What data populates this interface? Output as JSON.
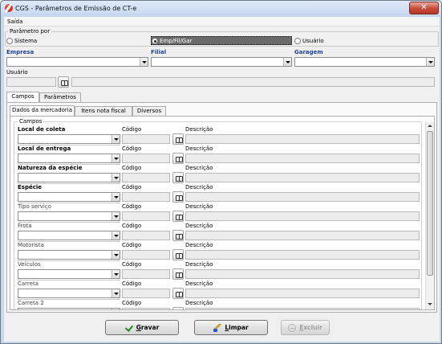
{
  "window": {
    "title": "CGS - Parâmetros de Emissão de CT-e",
    "close_glyph": "✕"
  },
  "menu": {
    "items": [
      {
        "label": "Saída"
      }
    ]
  },
  "parametro": {
    "group_label": "Parâmetro por",
    "options": [
      {
        "label": "Sistema",
        "selected": false
      },
      {
        "label": "Emp/Fil/Gar",
        "selected": true
      },
      {
        "label": "Usuário",
        "selected": false
      }
    ]
  },
  "filters": {
    "empresa_label": "Empresa",
    "filial_label": "Filial",
    "garagem_label": "Garagem",
    "usuario_label": "Usuário"
  },
  "outer_tabs": [
    {
      "label": "Campos",
      "active": true
    },
    {
      "label": "Parâmetros",
      "active": false
    }
  ],
  "inner_tabs": [
    {
      "label": "Dados da mercadoria",
      "active": true
    },
    {
      "label": "Itens nota fiscal",
      "active": false
    },
    {
      "label": "Diversos",
      "active": false
    }
  ],
  "campos": {
    "group_label": "Campos",
    "codigo_label": "Código",
    "descricao_label": "Descrição",
    "fields": [
      {
        "label": "Local de coleta",
        "bold": true
      },
      {
        "label": "Local de entrega",
        "bold": true
      },
      {
        "label": "Natureza da espécie",
        "bold": true
      },
      {
        "label": "Espécie",
        "bold": true
      },
      {
        "label": "Tipo serviço",
        "bold": false
      },
      {
        "label": "Frota",
        "bold": false
      },
      {
        "label": "Motorista",
        "bold": false
      },
      {
        "label": "Veículos",
        "bold": false
      },
      {
        "label": "Carreta",
        "bold": false
      },
      {
        "label": "Carreta 2",
        "bold": false
      }
    ]
  },
  "buttons": {
    "save_prefix": "",
    "save_accel": "G",
    "save_rest": "ravar",
    "clear_accel": "L",
    "clear_rest": "impar",
    "delete_accel": "E",
    "delete_rest": "xcluir"
  },
  "icons": [
    "app-logo-icon",
    "close-icon",
    "search-icon",
    "chevron-down-icon",
    "check-icon",
    "brush-icon",
    "delete-icon"
  ],
  "colors": {
    "accent_blue": "#1f3fa3",
    "title_bg": "#c4d6ee",
    "close_red": "#c7493a"
  }
}
